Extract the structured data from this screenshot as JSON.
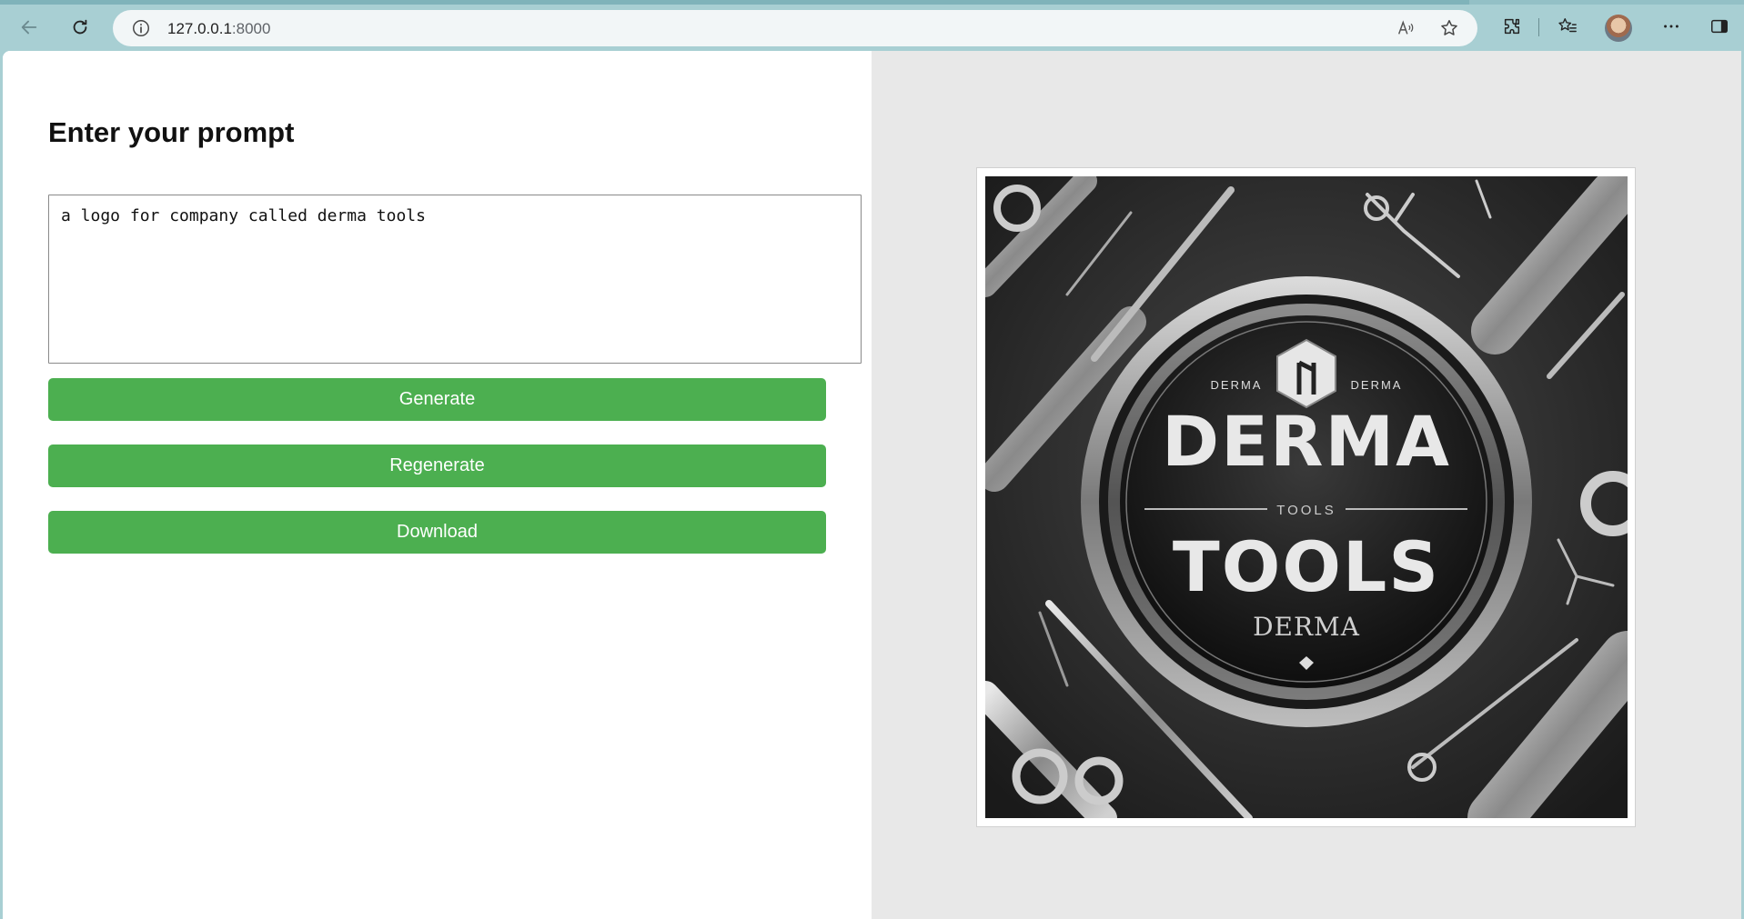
{
  "browser": {
    "url_host": "127.0.0.1",
    "url_port": ":8000"
  },
  "form": {
    "heading": "Enter your prompt",
    "prompt_value": "a logo for company called derma tools",
    "generate_label": "Generate",
    "regenerate_label": "Regenerate",
    "download_label": "Download"
  },
  "logo_image": {
    "small_left": "DERMA",
    "small_right": "DERMA",
    "main_top": "DERMA",
    "middle": "TOOLS",
    "main_bottom": "TOOLS",
    "script": "DERMA"
  },
  "colors": {
    "button_green": "#4caf50",
    "right_panel_bg": "#e8e8e8",
    "chrome_bg": "#a8cfd3"
  }
}
